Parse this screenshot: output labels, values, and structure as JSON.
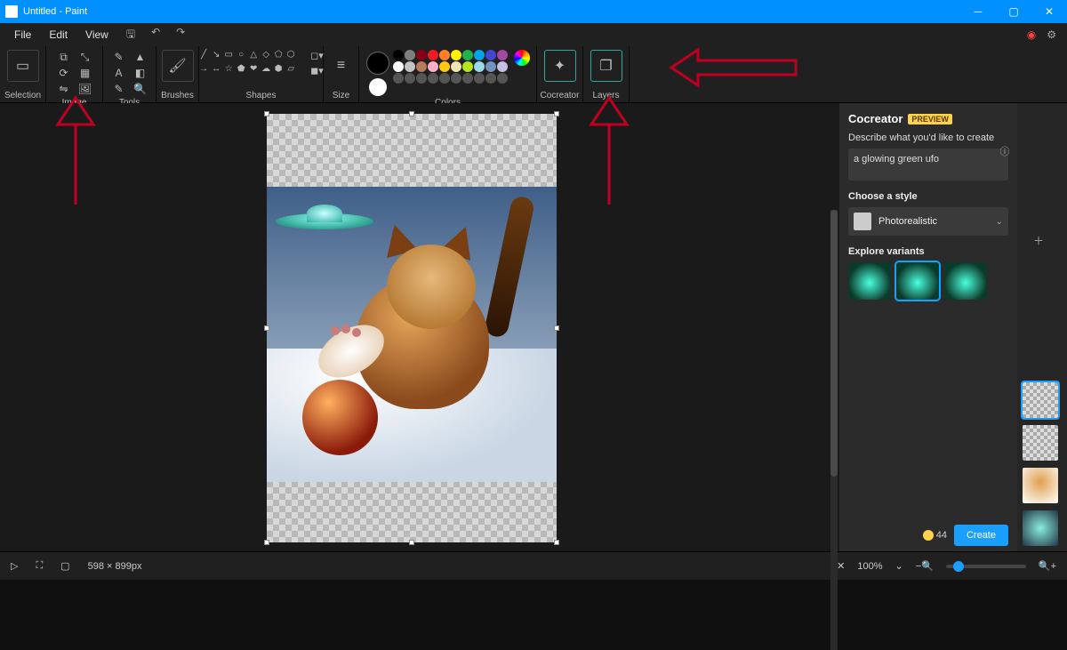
{
  "titlebar": {
    "title": "Untitled - Paint"
  },
  "menus": {
    "file": "File",
    "edit": "Edit",
    "view": "View"
  },
  "ribbon_groups": {
    "selection": "Selection",
    "image": "Image",
    "tools": "Tools",
    "brushes": "Brushes",
    "shapes": "Shapes",
    "size": "Size",
    "colors": "Colors",
    "cocreator": "Cocreator",
    "layers": "Layers"
  },
  "palette_row1": [
    "#000000",
    "#7f7f7f",
    "#880015",
    "#ed1c24",
    "#ff7f27",
    "#fff200",
    "#22b14c",
    "#00a2e8",
    "#3f48cc",
    "#a349a4"
  ],
  "palette_row2": [
    "#ffffff",
    "#c3c3c3",
    "#b97a57",
    "#ffaec9",
    "#ffc90e",
    "#efe4b0",
    "#b5e61d",
    "#99d9ea",
    "#7092be",
    "#c8bfe7"
  ],
  "palette_row3": [
    "#555555",
    "#555555",
    "#555555",
    "#555555",
    "#555555",
    "#555555",
    "#555555",
    "#555555",
    "#555555",
    "#555555"
  ],
  "primary_color": "#000000",
  "secondary_color": "#ffffff",
  "canvas": {
    "dimensions": "598 × 899px"
  },
  "cocreator": {
    "title": "Cocreator",
    "badge": "PREVIEW",
    "describe_label": "Describe what you'd like to create",
    "prompt": "a glowing green ufo",
    "style_label": "Choose a style",
    "style_selected": "Photorealistic",
    "variants_label": "Explore variants",
    "credits": "44",
    "create_label": "Create"
  },
  "status": {
    "zoom": "100%"
  }
}
